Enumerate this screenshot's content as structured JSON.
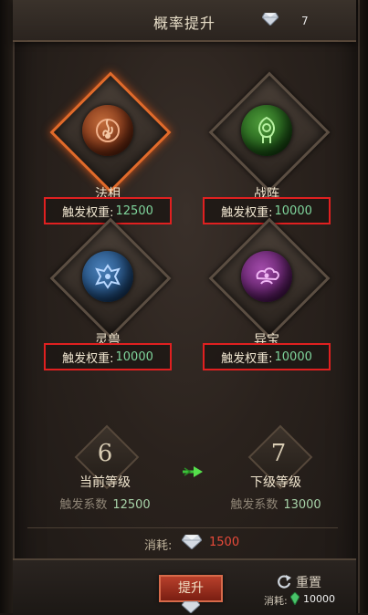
{
  "header": {
    "title": "概率提升",
    "currency_icon": "gem-icon",
    "currency_count": "7"
  },
  "slots": [
    {
      "name": "法相",
      "weight_label": "触发权重:",
      "weight_value": "12500",
      "icon": "fire-sigil-icon",
      "color": "#9a4420",
      "selected": true
    },
    {
      "name": "战阵",
      "weight_label": "触发权重:",
      "weight_value": "10000",
      "icon": "green-rune-icon",
      "color": "#2e7a24",
      "selected": false
    },
    {
      "name": "灵兽",
      "weight_label": "触发权重:",
      "weight_value": "10000",
      "icon": "beast-crest-icon",
      "color": "#2f5e96",
      "selected": false
    },
    {
      "name": "异宝",
      "weight_label": "触发权重:",
      "weight_value": "10000",
      "icon": "treasure-cloud-icon",
      "color": "#7a2a82",
      "selected": false
    }
  ],
  "current_level": {
    "value": "6",
    "label": "当前等级",
    "coef_label": "触发系数",
    "coef_value": "12500"
  },
  "next_level": {
    "value": "7",
    "label": "下级等级",
    "coef_label": "触发系数",
    "coef_value": "13000"
  },
  "cost": {
    "label": "消耗:",
    "icon": "gem-icon",
    "value": "1500",
    "value_color": "#e84a3a"
  },
  "upgrade_button": {
    "label": "提升"
  },
  "reset": {
    "label": "重置",
    "cost_label": "消耗:",
    "cost_icon": "green-crystal-icon",
    "cost_value": "10000"
  }
}
